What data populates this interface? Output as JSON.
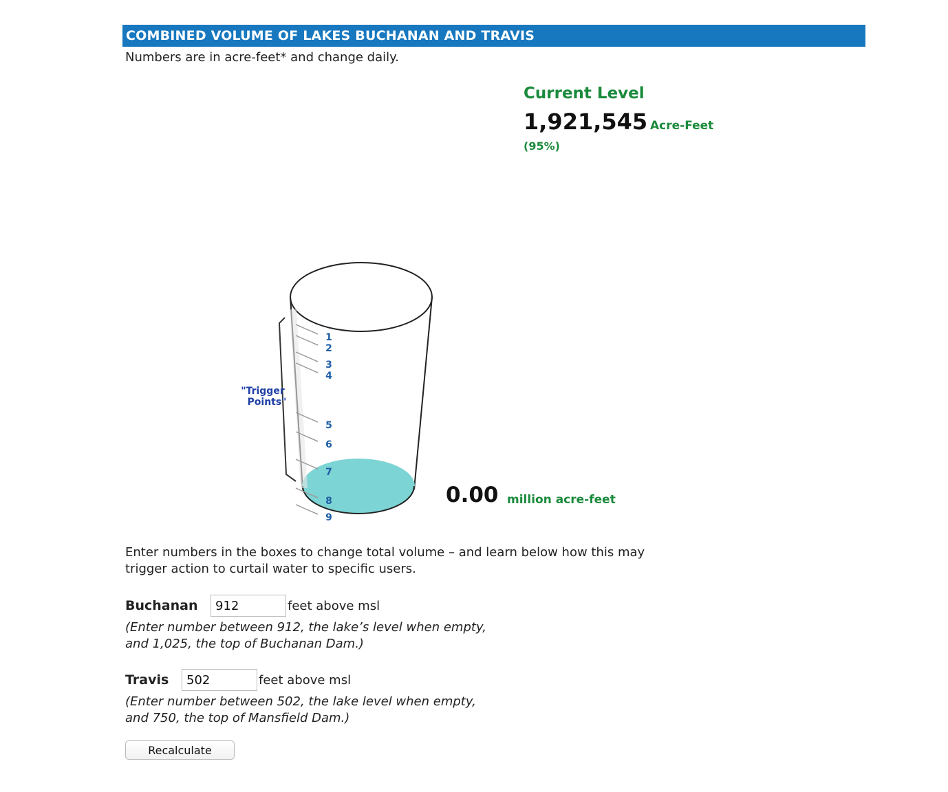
{
  "header": {
    "title": "COMBINED VOLUME OF LAKES BUCHANAN AND TRAVIS"
  },
  "subtitle": "Numbers are in acre-feet* and change daily.",
  "current_level": {
    "label": "Current Level",
    "value": "1,921,545",
    "unit": "Acre-Feet",
    "percent": "(95%)"
  },
  "gauge": {
    "trigger_label_line1": "\"Trigger",
    "trigger_label_line2": "Points\"",
    "ticks": [
      "1",
      "2",
      "3",
      "4",
      "5",
      "6",
      "7",
      "8",
      "9"
    ],
    "fill_fraction": 0.0,
    "water_color": "#7dd4d4",
    "tick_color": "#1f5fa6"
  },
  "volume": {
    "value": "0.00",
    "unit": "million acre-feet"
  },
  "instructions": "Enter numbers in the boxes to change total volume – and learn below how this may trigger action to curtail water to specific users.",
  "buchanan": {
    "label": "Buchanan",
    "value": "912",
    "unit": "feet above msl",
    "hint_line1": "(Enter number between 912, the lake’s level when empty,",
    "hint_line2": "and 1,025, the top of Buchanan Dam.)"
  },
  "travis": {
    "label": "Travis",
    "value": "502",
    "unit": "feet above msl",
    "hint_line1": "(Enter number between 502, the lake level when empty,",
    "hint_line2": "and 750, the top of Mansfield Dam.)"
  },
  "button": {
    "recalculate": "Recalculate"
  },
  "colors": {
    "header_bg": "#1878bf",
    "accent_green": "#1a8a3c"
  }
}
